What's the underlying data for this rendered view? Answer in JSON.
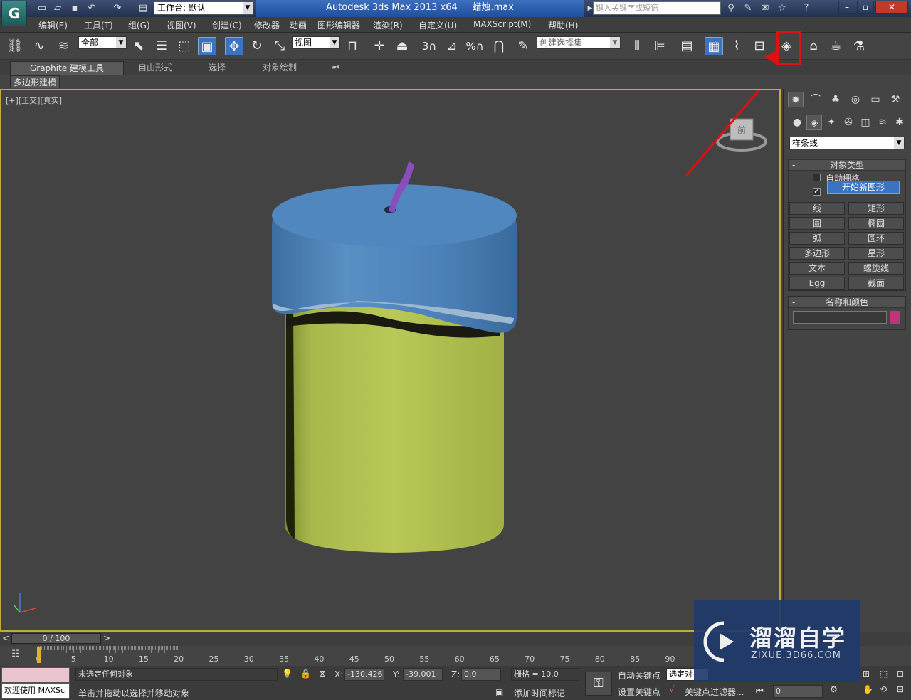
{
  "titlebar": {
    "workspace": "工作台: 默认",
    "title": "Autodesk 3ds Max  2013 x64",
    "file": "蜡烛.max",
    "search_placeholder": "键入关键字或短语"
  },
  "menu": [
    "编辑(E)",
    "工具(T)",
    "组(G)",
    "视图(V)",
    "创建(C)",
    "修改器",
    "动画",
    "图形编辑器",
    "渲染(R)",
    "自定义(U)",
    "MAXScript(M)",
    "帮助(H)"
  ],
  "toolbar": {
    "filter": "全部",
    "coord": "视图",
    "selset": "创建选择集",
    "snap_3": "3",
    "snap_pct": "%"
  },
  "ribbon": {
    "tabs": [
      "Graphite 建模工具",
      "自由形式",
      "选择",
      "对象绘制"
    ],
    "subtab": "多边形建模"
  },
  "viewport": {
    "label_plus": "[+]",
    "label_view": "[正交]",
    "label_shade": "[真实]",
    "viewcube_face": "前"
  },
  "cmdpanel": {
    "category": "样条线",
    "rollout_objtype": "对象类型",
    "autogrid": "自动栅格",
    "start_new_shape": "开始新图形",
    "buttons": [
      "线",
      "矩形",
      "圆",
      "椭圆",
      "弧",
      "圆环",
      "多边形",
      "星形",
      "文本",
      "螺旋线",
      "Egg",
      "截面"
    ],
    "rollout_namecolor": "名称和颜色",
    "swatch_color": "#c4307a"
  },
  "timeline": {
    "position": "0 / 100",
    "ticks": [
      "0",
      "5",
      "10",
      "15",
      "20",
      "25",
      "30",
      "35",
      "40",
      "45",
      "50",
      "55",
      "60",
      "65",
      "70",
      "75",
      "80",
      "85",
      "90"
    ]
  },
  "status": {
    "welcome": "欢迎使用 MAXSc",
    "selection": "未选定任何对象",
    "prompt": "单击并拖动以选择并移动对象",
    "x_label": "X:",
    "x": "-130.426",
    "y_label": "Y:",
    "y": "-39.001",
    "z_label": "Z:",
    "z": "0.0",
    "grid": "栅格 = 10.0",
    "autokey": "自动关键点",
    "setkey": "设置关键点",
    "selected": "选定对",
    "keyfilter": "关键点过滤器...",
    "add_time_tag": "添加时间标记",
    "frame": "0"
  },
  "watermark": {
    "brand": "溜溜自学",
    "url": "ZIXUE.3D66.COM"
  }
}
